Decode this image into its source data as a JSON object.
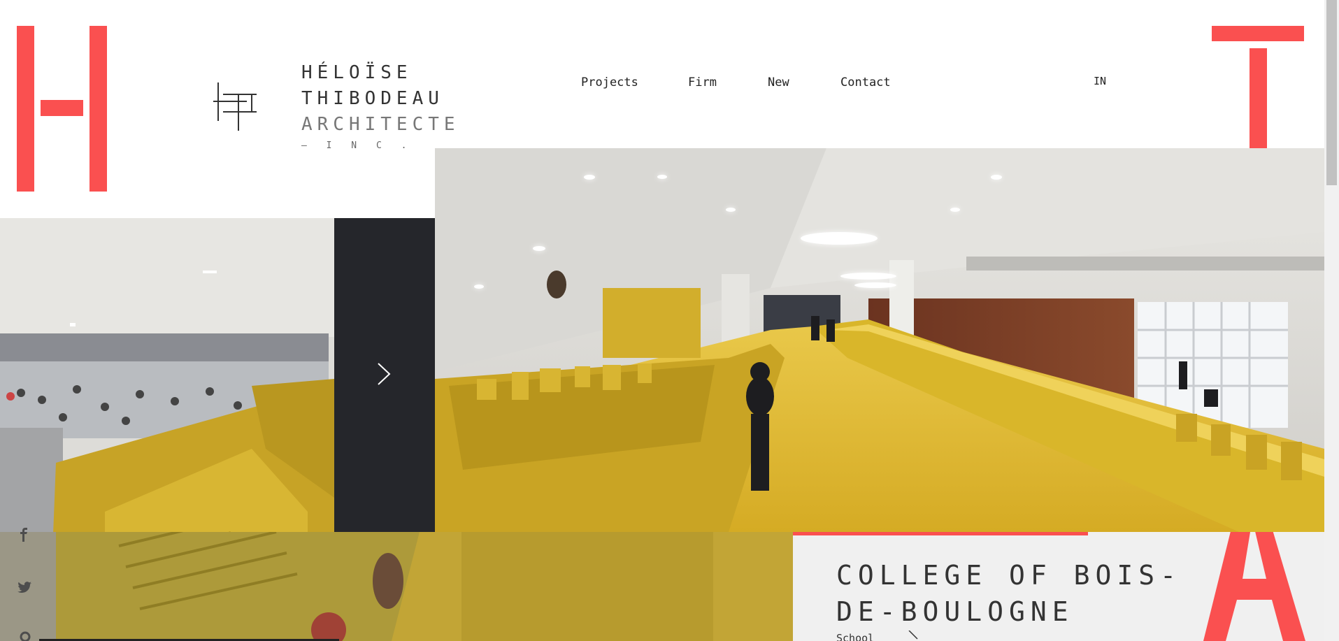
{
  "logo": {
    "line1": "HÉLOÏSE",
    "line2": "THIBODEAU",
    "line3": "ARCHITECTE",
    "line4": "— I N C ."
  },
  "nav": {
    "projects": "Projects",
    "firm": "Firm",
    "new": "New",
    "contact": "Contact",
    "language": "IN"
  },
  "project": {
    "title": "COLLEGE OF BOIS-DE-BOULOGNE",
    "category": "School"
  },
  "colors": {
    "accent": "#fa5050",
    "dark_panel": "#25262b",
    "yellow": "#d9b62a"
  },
  "icons": {
    "next": "chevron-right-icon",
    "facebook": "facebook-icon",
    "twitter": "twitter-icon",
    "pinterest": "pinterest-icon"
  }
}
